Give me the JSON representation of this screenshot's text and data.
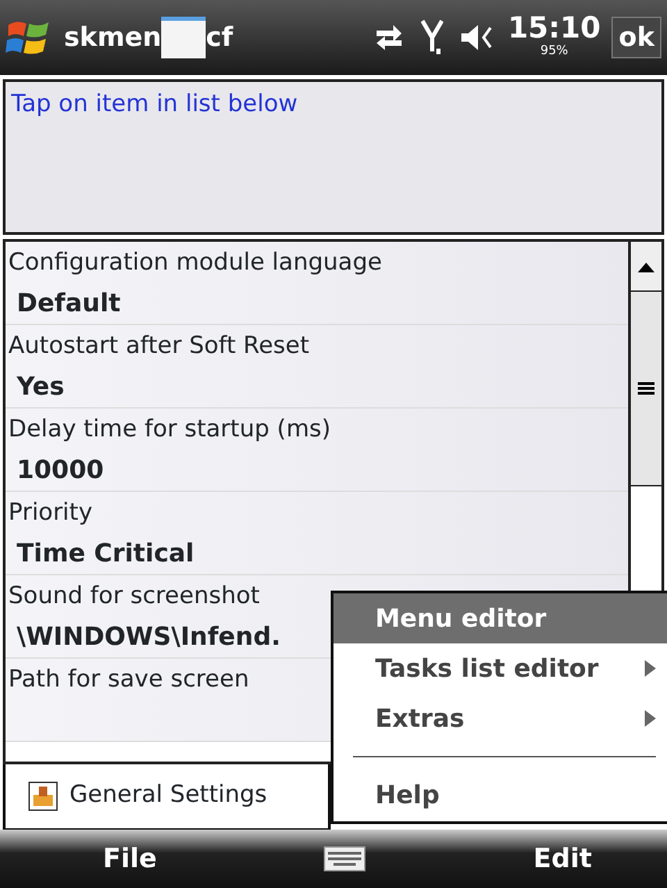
{
  "status_bar": {
    "title_parts": [
      "skmen",
      "cf"
    ],
    "time": "15:10",
    "battery": "95%",
    "ok_button": "ok"
  },
  "info_box": {
    "text": "Tap on item in list below"
  },
  "settings": [
    {
      "label": "Configuration module language",
      "value": "Default"
    },
    {
      "label": "Autostart after Soft Reset",
      "value": "Yes"
    },
    {
      "label": "Delay time for startup (ms)",
      "value": "10000"
    },
    {
      "label": "Priority",
      "value": "Time Critical"
    },
    {
      "label": "Sound for screenshot",
      "value": "\\WINDOWS\\Infend."
    },
    {
      "label": "Path for save screen"
    }
  ],
  "tab": {
    "label": "General Settings"
  },
  "menu": [
    {
      "kind": "item",
      "label": "Menu editor",
      "selected": true,
      "submenu": false
    },
    {
      "kind": "item",
      "label": "Tasks list editor",
      "selected": false,
      "submenu": true
    },
    {
      "kind": "item",
      "label": "Extras",
      "selected": false,
      "submenu": true
    },
    {
      "kind": "separator"
    },
    {
      "kind": "item",
      "label": "Help",
      "selected": false,
      "submenu": false
    }
  ],
  "softkeys": {
    "left": "File",
    "right": "Edit"
  }
}
